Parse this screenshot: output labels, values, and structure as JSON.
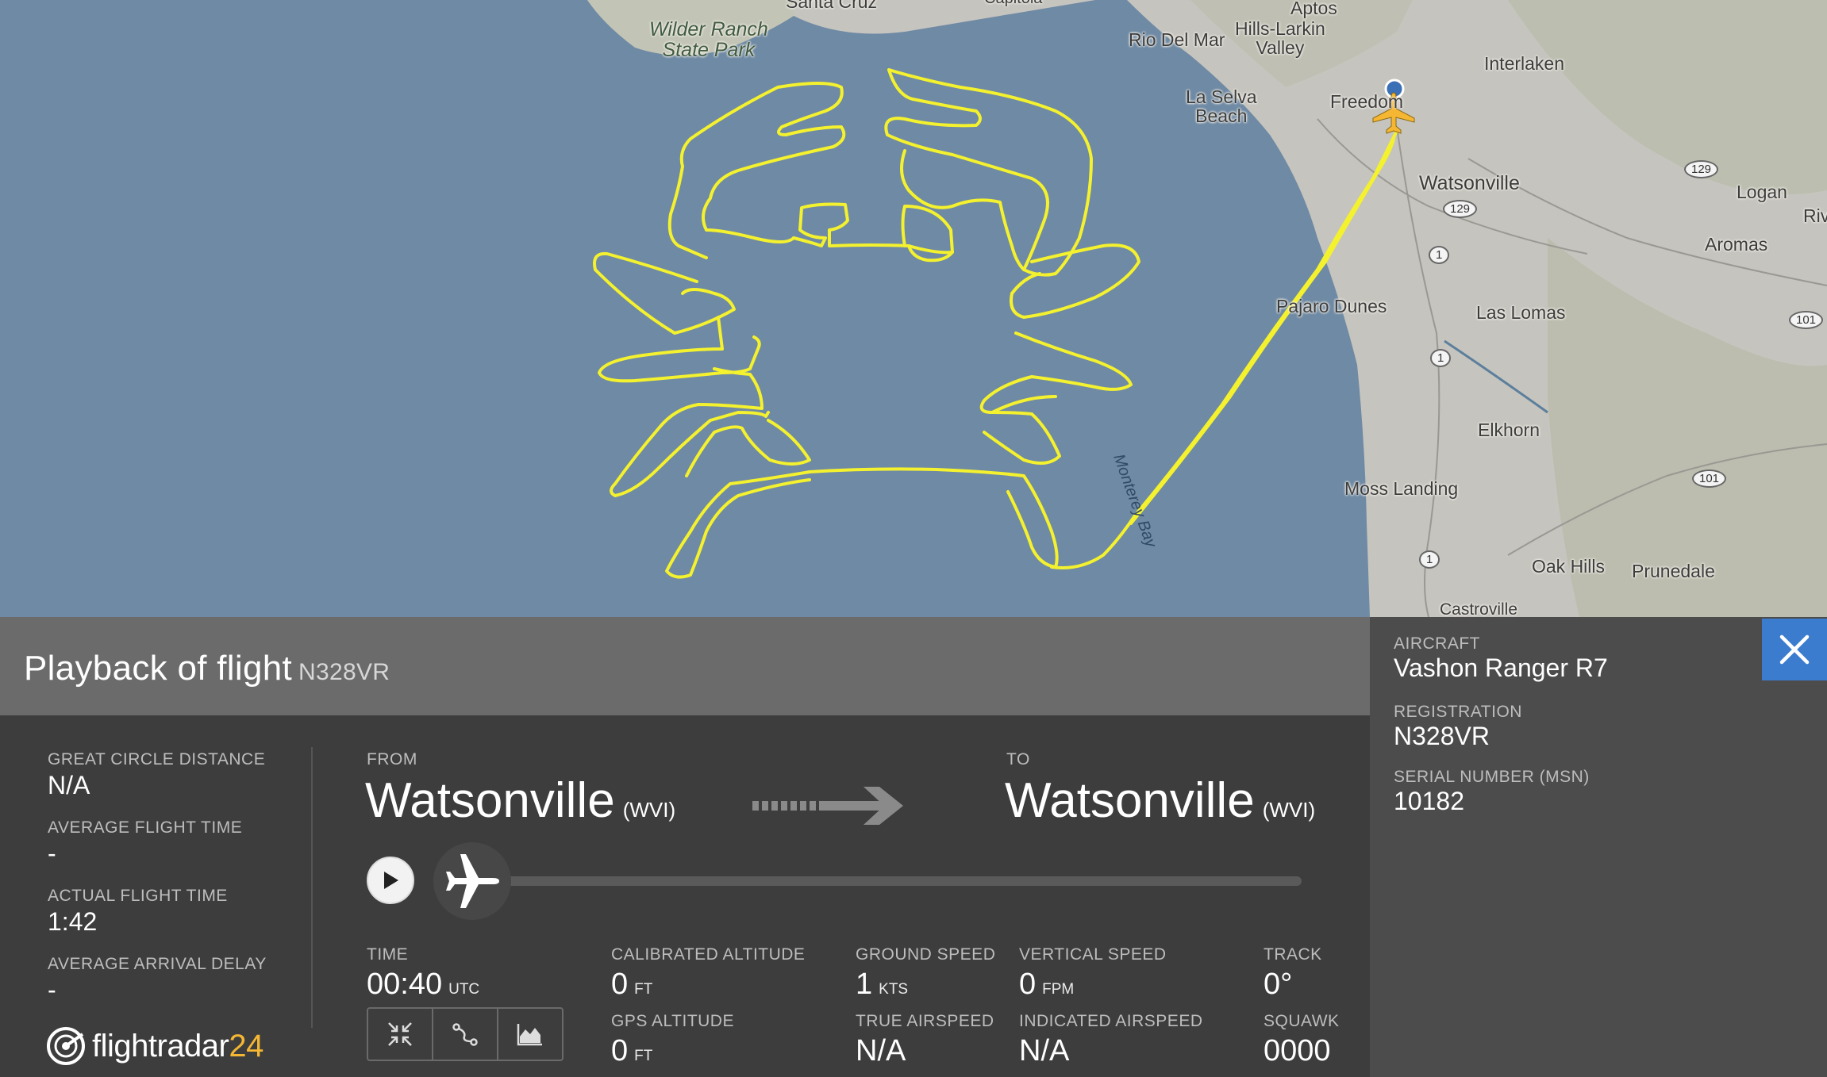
{
  "map": {
    "places": {
      "santa_cruz": "Santa Cruz",
      "capitola": "Capitola",
      "wilder_ranch": "Wilder Ranch\nState Park",
      "aptos": "Aptos",
      "aptos_hills": "Hills-Larkin\nValley",
      "rio_del_mar": "Rio Del Mar",
      "la_selva": "La Selva\nBeach",
      "freedom": "Freedom",
      "interlaken": "Interlaken",
      "watsonville": "Watsonville",
      "logan": "Logan",
      "aromas": "Aromas",
      "riv": "Riv",
      "pajaro_dunes": "Pajaro Dunes",
      "las_lomas": "Las Lomas",
      "elkhorn": "Elkhorn",
      "moss_landing": "Moss Landing",
      "oak_hills": "Oak Hills",
      "prunedale": "Prunedale",
      "castroville": "Castroville",
      "monterey_bay": "Monterey Bay"
    },
    "shields": [
      "129",
      "129",
      "1",
      "1",
      "1",
      "101",
      "101"
    ],
    "track_color": "#f4f12e",
    "water_color": "#6f8aa4",
    "land_color": "#c6c4be"
  },
  "header": {
    "title": "Playback of flight",
    "registration": "N328VR"
  },
  "stats": {
    "great_circle_label": "GREAT CIRCLE DISTANCE",
    "great_circle_value": "N/A",
    "avg_flight_time_label": "AVERAGE FLIGHT TIME",
    "avg_flight_time_value": "-",
    "actual_flight_time_label": "ACTUAL FLIGHT TIME",
    "actual_flight_time_value": "1:42",
    "avg_arrival_delay_label": "AVERAGE ARRIVAL DELAY",
    "avg_arrival_delay_value": "-"
  },
  "route": {
    "from_label": "FROM",
    "from_city": "Watsonville",
    "from_code": "(WVI)",
    "to_label": "TO",
    "to_city": "Watsonville",
    "to_code": "(WVI)"
  },
  "playback": {
    "progress": 0.0
  },
  "telemetry": {
    "time_label": "TIME",
    "time_value": "00:40",
    "time_unit": "UTC",
    "cal_alt_label": "CALIBRATED ALTITUDE",
    "cal_alt_value": "0",
    "cal_alt_unit": "FT",
    "gps_alt_label": "GPS ALTITUDE",
    "gps_alt_value": "0",
    "gps_alt_unit": "FT",
    "ground_speed_label": "GROUND SPEED",
    "ground_speed_value": "1",
    "ground_speed_unit": "KTS",
    "true_airspeed_label": "TRUE AIRSPEED",
    "true_airspeed_value": "N/A",
    "vertical_speed_label": "VERTICAL SPEED",
    "vertical_speed_value": "0",
    "vertical_speed_unit": "FPM",
    "indicated_airspeed_label": "INDICATED AIRSPEED",
    "indicated_airspeed_value": "N/A",
    "track_label": "TRACK",
    "track_value": "0°",
    "squawk_label": "SQUAWK",
    "squawk_value": "0000"
  },
  "aircraft": {
    "aircraft_label": "AIRCRAFT",
    "aircraft_value": "Vashon Ranger R7",
    "registration_label": "REGISTRATION",
    "registration_value": "N328VR",
    "serial_label": "SERIAL NUMBER (MSN)",
    "serial_value": "10182"
  },
  "logo": {
    "text_main": "flightradar",
    "text_num": "24"
  },
  "icons": {
    "play": "play-icon",
    "plane": "airplane-icon",
    "close": "close-icon",
    "collapse": "collapse-icon",
    "route": "route-icon",
    "graph": "graph-icon"
  }
}
